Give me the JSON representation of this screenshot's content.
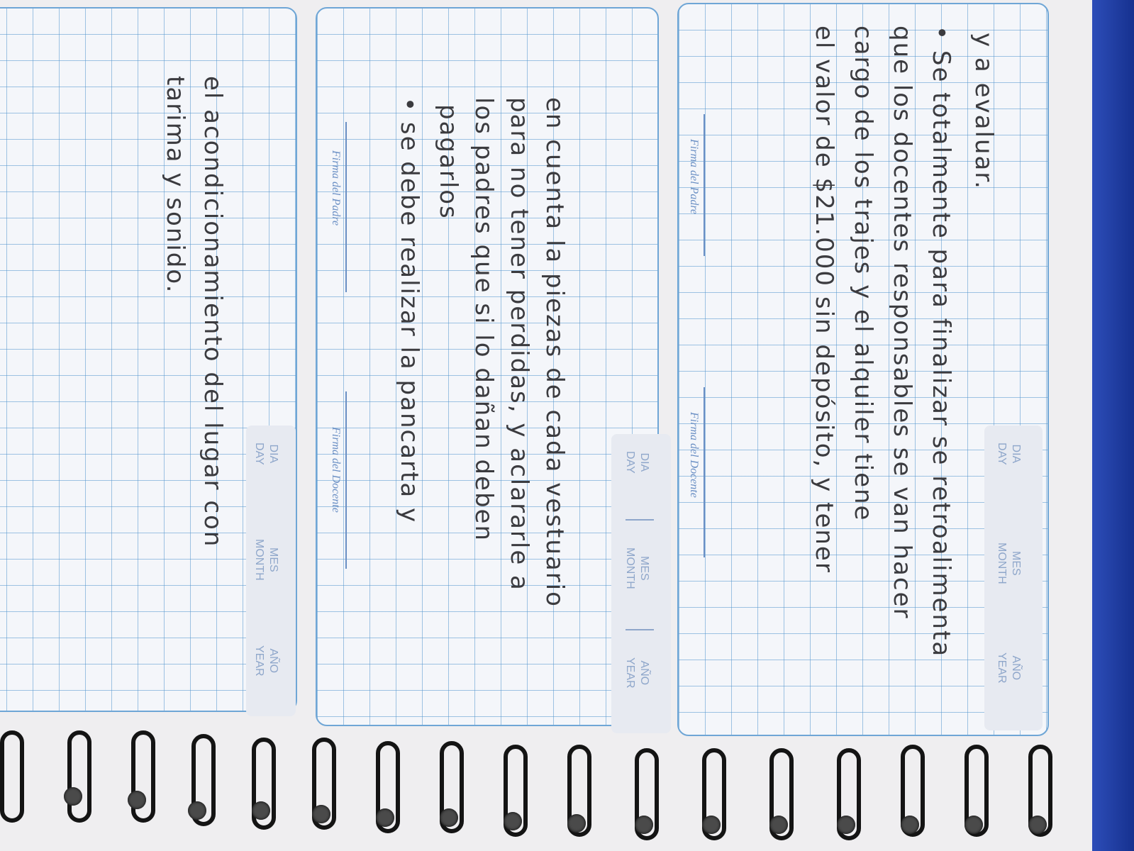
{
  "lines_right": [
    "y a evaluar.",
    "• Se totalmente para finalizar se retroalimenta",
    "que los docentes responsables se van hacer",
    "cargo de los trajes y el alquiler tiene",
    "el valor de $21.000 sin depósito, y tener"
  ],
  "lines_middle": [
    "en cuenta la piezas de cada vestuario",
    "para no tener perdidas, y aclararle a",
    "los padres que si lo dañan deben",
    "pagarlos",
    "• se debe realizar la pancarta y"
  ],
  "lines_left": [
    "el acondicionamiento del lugar con",
    "tarima y sonido."
  ],
  "signatures": {
    "father": "Firma del Padre",
    "teacher": "Firma del Docente"
  },
  "date_fields": {
    "day": [
      "DIA",
      "DAY"
    ],
    "month": [
      "MES",
      "MONTH"
    ],
    "year": [
      "AÑO",
      "YEAR"
    ]
  }
}
